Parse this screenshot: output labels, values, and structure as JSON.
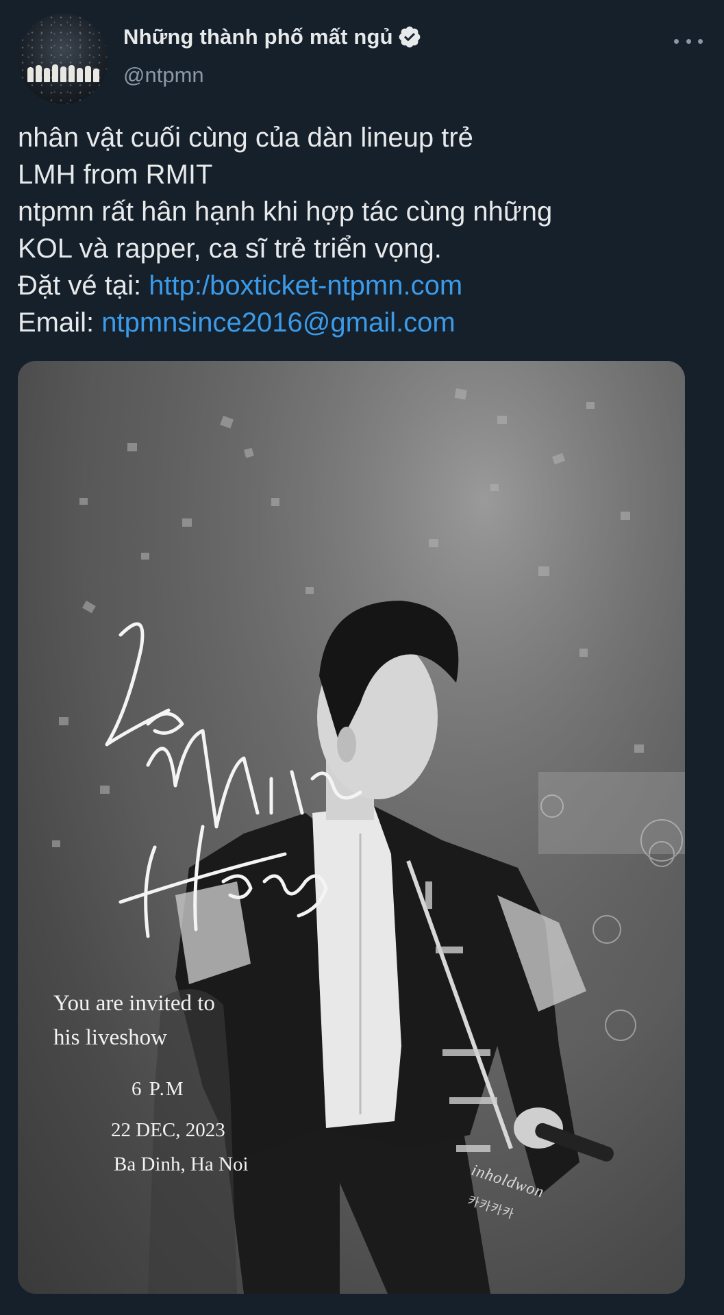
{
  "author": {
    "display_name": "Những thành phố mất ngủ",
    "handle": "@ntpmn",
    "verified": true,
    "avatar_icon": "avatar-concert-photo"
  },
  "menu": {
    "icon": "more-icon"
  },
  "tweet": {
    "line1": "nhân vật cuối cùng của dàn lineup trẻ",
    "line2": "LMH from RMIT",
    "line3": "ntpmn rất hân hạnh khi hợp tác cùng những",
    "line4": "KOL và rapper, ca sĩ trẻ triển vọng.",
    "ticket_prefix": "Đặt vé tại: ",
    "ticket_link": "http:/boxticket-ntpmn.com",
    "email_prefix": "Email: ",
    "email_link": "ntpmnsince2016@gmail.com"
  },
  "media": {
    "script_name": "Le Minh Huong",
    "invite_line1": "You are invited to",
    "invite_line2": "his liveshow",
    "time": "6 P.M",
    "date": "22 DEC, 2023",
    "place": "Ba Dinh, Ha Noi",
    "watermark": "inholdwon",
    "watermark_sub": "카카카카",
    "link_color": "#3b9be9"
  }
}
